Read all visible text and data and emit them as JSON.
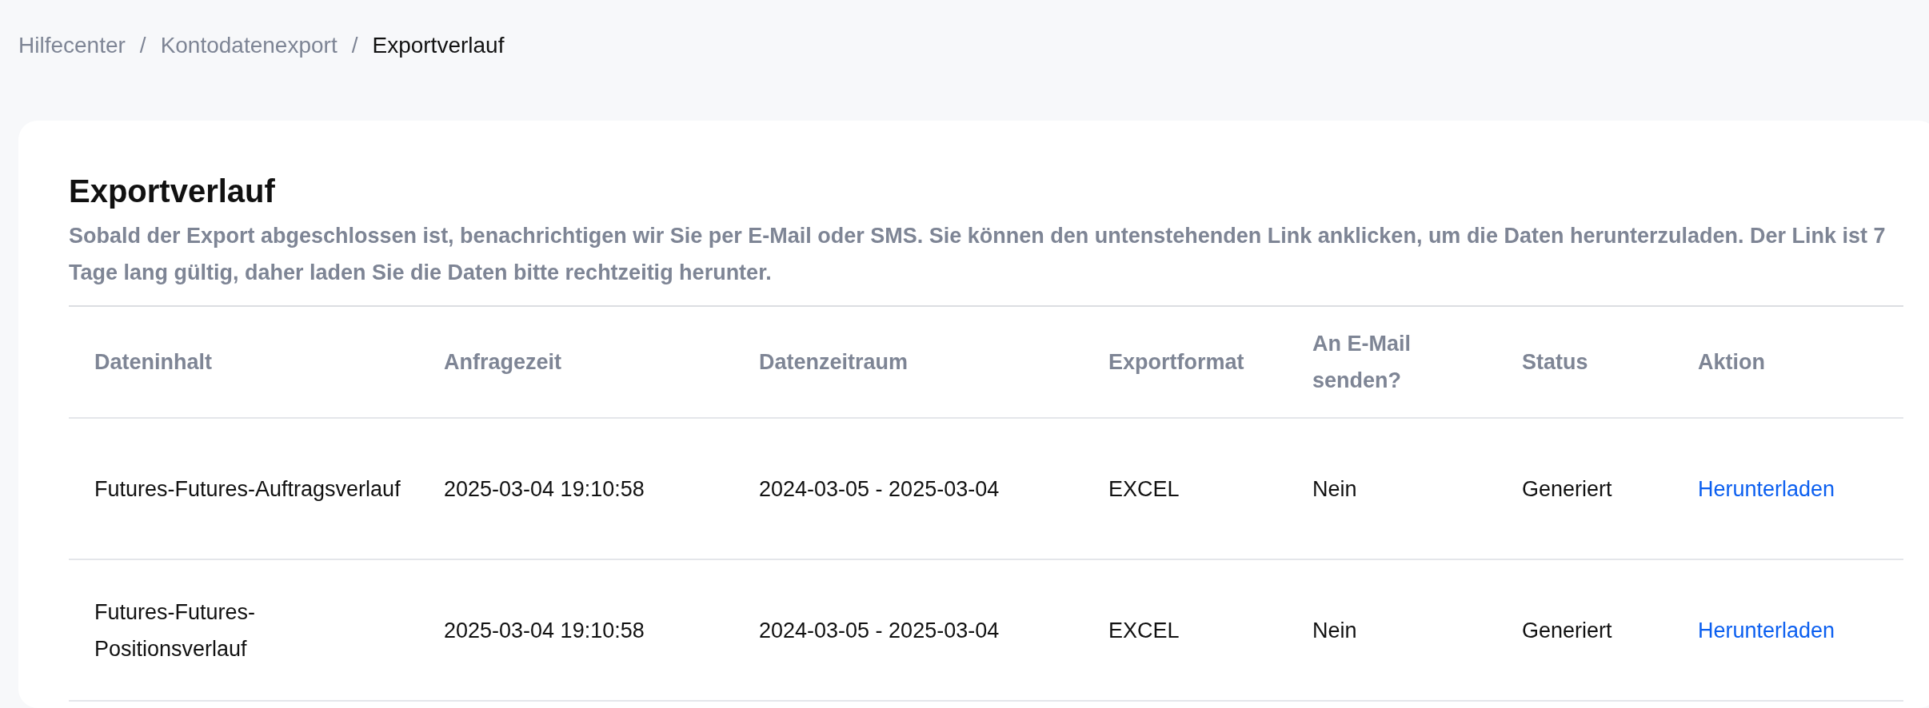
{
  "breadcrumb": [
    {
      "label": "Hilfecenter",
      "current": false
    },
    {
      "label": "Kontodatenexport",
      "current": false
    },
    {
      "label": "Exportverlauf",
      "current": true
    }
  ],
  "separator": "/",
  "title": "Exportverlauf",
  "description": "Sobald der Export abgeschlossen ist, benachrichtigen wir Sie per E-Mail oder SMS. Sie können den untenstehenden Link anklicken, um die Daten herunterzuladen. Der Link ist 7 Tage lang gültig, daher laden Sie die Daten bitte rechtzeitig herunter.",
  "table": {
    "columns": [
      "Dateninhalt",
      "Anfragezeit",
      "Datenzeitraum",
      "Exportformat",
      "An E-Mail senden?",
      "Status",
      "Aktion"
    ],
    "rows": [
      {
        "content": "Futures-Futures-Auftragsverlauf",
        "requested": "2025-03-04 19:10:58",
        "period": "2024-03-05 - 2025-03-04",
        "format": "EXCEL",
        "email": "Nein",
        "status": "Generiert",
        "action": "Herunterladen"
      },
      {
        "content": "Futures-Futures-Positionsverlauf",
        "requested": "2025-03-04 19:10:58",
        "period": "2024-03-05 - 2025-03-04",
        "format": "EXCEL",
        "email": "Nein",
        "status": "Generiert",
        "action": "Herunterladen"
      }
    ]
  }
}
